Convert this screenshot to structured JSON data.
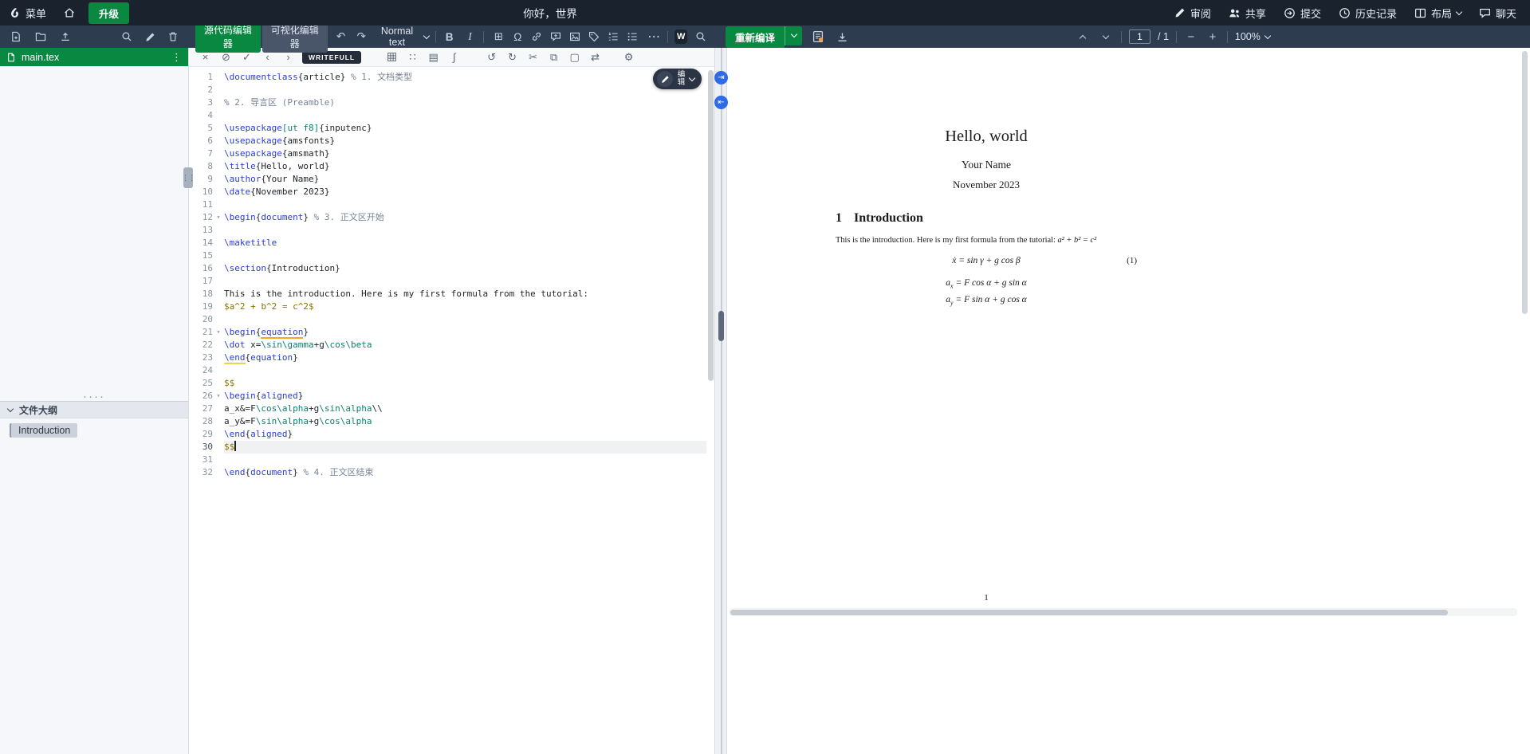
{
  "header": {
    "menu_label": "菜单",
    "upgrade_label": "升级",
    "project_title": "你好，世界",
    "actions": [
      {
        "label": "审阅",
        "icon": "review"
      },
      {
        "label": "共享",
        "icon": "share"
      },
      {
        "label": "提交",
        "icon": "submit"
      },
      {
        "label": "历史记录",
        "icon": "history"
      },
      {
        "label": "布局",
        "icon": "layout",
        "chevron": true
      },
      {
        "label": "聊天",
        "icon": "chat"
      }
    ]
  },
  "file_toolbar": {
    "left_icons": [
      {
        "name": "new-file-icon",
        "svg": "doc-plus"
      },
      {
        "name": "new-folder-icon",
        "svg": "folder"
      },
      {
        "name": "upload-file-icon",
        "svg": "upload"
      }
    ],
    "right_icons": [
      {
        "name": "search-files-icon",
        "svg": "search"
      },
      {
        "name": "rename-icon",
        "svg": "pencil"
      },
      {
        "name": "delete-icon",
        "svg": "trash"
      }
    ]
  },
  "file_tree": {
    "file_name": "main.tex",
    "outline_header": "文件大纲",
    "outline_items": [
      "Introduction"
    ]
  },
  "editor_toolbar": {
    "source_label": "源代码编辑器",
    "visual_label": "可视化编辑器",
    "paragraph_style": "Normal text",
    "bold_label": "B",
    "italic_label": "I",
    "more_label": "⋯",
    "writefull_w": "W",
    "icons": [
      {
        "name": "insert-table-icon",
        "glyph": "⊞"
      },
      {
        "name": "insert-symbol-icon",
        "glyph": "Ω"
      },
      {
        "name": "insert-link-icon",
        "svg": "link"
      },
      {
        "name": "add-comment-icon",
        "svg": "comment"
      },
      {
        "name": "insert-figure-icon",
        "svg": "figure"
      },
      {
        "name": "insert-label-icon",
        "svg": "tag"
      },
      {
        "name": "numbered-list-icon",
        "svg": "list-num"
      },
      {
        "name": "bulleted-list-icon",
        "svg": "list-bul"
      }
    ]
  },
  "writefull_toolbar": {
    "label": "WRITEFULL",
    "left_icons": [
      {
        "name": "close-icon",
        "glyph": "×"
      },
      {
        "name": "disable-icon",
        "glyph": "⊘"
      },
      {
        "name": "accept-icon",
        "glyph": "✓"
      },
      {
        "name": "previous-suggestion-icon",
        "glyph": "‹"
      },
      {
        "name": "next-suggestion-icon",
        "glyph": "›"
      }
    ],
    "tool_icons": [
      {
        "name": "table-generator-icon",
        "svg": "grid"
      },
      {
        "name": "matrix-tool-icon",
        "glyph": "∷"
      },
      {
        "name": "notes-tool-icon",
        "glyph": "▤"
      },
      {
        "name": "equation-tool-icon",
        "glyph": "∫"
      }
    ],
    "action_icons": [
      {
        "name": "undo-icon",
        "glyph": "↺"
      },
      {
        "name": "redo-icon",
        "glyph": "↻"
      },
      {
        "name": "cut-icon",
        "glyph": "✂"
      },
      {
        "name": "copy-icon",
        "glyph": "⧉"
      },
      {
        "name": "paste-icon",
        "glyph": "▢"
      },
      {
        "name": "swap-icon",
        "glyph": "⇄"
      }
    ],
    "settings_icon": {
      "name": "settings-icon",
      "glyph": "⚙"
    }
  },
  "review_pill": {
    "label": "编辑"
  },
  "pdf_toolbar": {
    "recompile_label": "重新编译",
    "page_current": "1",
    "page_total": "/ 1",
    "zoom": "100%"
  },
  "pdf_doc": {
    "title": "Hello, world",
    "author": "Your Name",
    "date": "November 2023",
    "section_number": "1",
    "section_title": "Introduction",
    "body_text": "This is the introduction. Here is my first formula from the tutorial: ",
    "body_formula": "a² + b² = c²",
    "equation_1": "ẋ = sin γ + g cos β",
    "equation_1_number": "(1)",
    "equation_2a_var": "a",
    "equation_2a_sub": "x",
    "equation_2a_rhs": " = F cos α + g sin α",
    "equation_2b_var": "a",
    "equation_2b_sub": "y",
    "equation_2b_rhs": " = F sin α + g cos α",
    "page_footer": "1"
  },
  "code": {
    "lines": [
      {
        "n": 1,
        "tokens": [
          [
            "cmd",
            "\\documentclass"
          ],
          [
            "txt",
            "{article} "
          ],
          [
            "cmt",
            "% 1. 文档类型"
          ]
        ]
      },
      {
        "n": 2,
        "tokens": []
      },
      {
        "n": 3,
        "tokens": [
          [
            "cmt",
            "% 2. 导言区 (Preamble)"
          ]
        ]
      },
      {
        "n": 4,
        "tokens": []
      },
      {
        "n": 5,
        "tokens": [
          [
            "cmd",
            "\\usepackage"
          ],
          [
            "opt",
            "[ut f8]"
          ],
          [
            "txt",
            "{inputenc}"
          ]
        ]
      },
      {
        "n": 6,
        "tokens": [
          [
            "cmd",
            "\\usepackage"
          ],
          [
            "txt",
            "{amsfonts}"
          ]
        ]
      },
      {
        "n": 7,
        "tokens": [
          [
            "cmd",
            "\\usepackage"
          ],
          [
            "txt",
            "{amsmath}"
          ]
        ]
      },
      {
        "n": 8,
        "tokens": [
          [
            "cmd",
            "\\title"
          ],
          [
            "txt",
            "{Hello, world}"
          ]
        ]
      },
      {
        "n": 9,
        "tokens": [
          [
            "cmd",
            "\\author"
          ],
          [
            "txt",
            "{Your Name}"
          ]
        ]
      },
      {
        "n": 10,
        "tokens": [
          [
            "cmd",
            "\\date"
          ],
          [
            "txt",
            "{November 2023}"
          ]
        ]
      },
      {
        "n": 11,
        "tokens": []
      },
      {
        "n": 12,
        "fold": true,
        "tokens": [
          [
            "cmd",
            "\\begin"
          ],
          [
            "txt",
            "{"
          ],
          [
            "env",
            "document"
          ],
          [
            "txt",
            "} "
          ],
          [
            "cmt",
            "% 3. 正文区开始"
          ]
        ]
      },
      {
        "n": 13,
        "tokens": []
      },
      {
        "n": 14,
        "tokens": [
          [
            "cmd",
            "\\maketitle"
          ]
        ]
      },
      {
        "n": 15,
        "tokens": []
      },
      {
        "n": 16,
        "tokens": [
          [
            "cmd",
            "\\section"
          ],
          [
            "txt",
            "{Introduction}"
          ]
        ]
      },
      {
        "n": 17,
        "tokens": []
      },
      {
        "n": 18,
        "tokens": [
          [
            "txt",
            "This is the introduction. Here is my first formula from the tutorial:"
          ]
        ]
      },
      {
        "n": 19,
        "tokens": [
          [
            "math",
            "$a^2 + b^2 = c^2$"
          ]
        ]
      },
      {
        "n": 20,
        "tokens": []
      },
      {
        "n": 21,
        "fold": true,
        "tokens": [
          [
            "cmd",
            "\\begin"
          ],
          [
            "txt",
            "{"
          ],
          [
            "env ulo",
            "equation"
          ],
          [
            "txt",
            "}"
          ]
        ]
      },
      {
        "n": 22,
        "tokens": [
          [
            "cmd",
            "\\dot"
          ],
          [
            "txt",
            " x="
          ],
          [
            "mcmd",
            "\\sin\\gamma"
          ],
          [
            "txt",
            "+g"
          ],
          [
            "mcmd",
            "\\cos\\beta"
          ]
        ]
      },
      {
        "n": 23,
        "tokens": [
          [
            "cmd uly",
            "\\end"
          ],
          [
            "txt",
            "{"
          ],
          [
            "env",
            "equation"
          ],
          [
            "txt",
            "}"
          ]
        ]
      },
      {
        "n": 24,
        "tokens": []
      },
      {
        "n": 25,
        "tokens": [
          [
            "math",
            "$$"
          ]
        ]
      },
      {
        "n": 26,
        "fold": true,
        "tokens": [
          [
            "cmd",
            "\\begin"
          ],
          [
            "txt",
            "{"
          ],
          [
            "env",
            "aligned"
          ],
          [
            "txt",
            "}"
          ]
        ]
      },
      {
        "n": 27,
        "tokens": [
          [
            "txt",
            "a_x&=F"
          ],
          [
            "mcmd",
            "\\cos\\alpha"
          ],
          [
            "txt",
            "+g"
          ],
          [
            "mcmd",
            "\\sin\\alpha"
          ],
          [
            "txt",
            "\\\\"
          ]
        ]
      },
      {
        "n": 28,
        "tokens": [
          [
            "txt",
            "a_y&=F"
          ],
          [
            "mcmd",
            "\\sin\\alpha"
          ],
          [
            "txt",
            "+g"
          ],
          [
            "mcmd",
            "\\cos\\alpha"
          ]
        ]
      },
      {
        "n": 29,
        "tokens": [
          [
            "cmd",
            "\\end"
          ],
          [
            "txt",
            "{"
          ],
          [
            "env",
            "aligned"
          ],
          [
            "txt",
            "}"
          ]
        ]
      },
      {
        "n": 30,
        "active": true,
        "cursor": true,
        "tokens": [
          [
            "math",
            "$$"
          ]
        ]
      },
      {
        "n": 31,
        "tokens": []
      },
      {
        "n": 32,
        "tokens": [
          [
            "cmd",
            "\\end"
          ],
          [
            "txt",
            "{"
          ],
          [
            "env",
            "document"
          ],
          [
            "txt",
            "} "
          ],
          [
            "cmt",
            "% 4. 正文区结束"
          ]
        ]
      }
    ]
  }
}
